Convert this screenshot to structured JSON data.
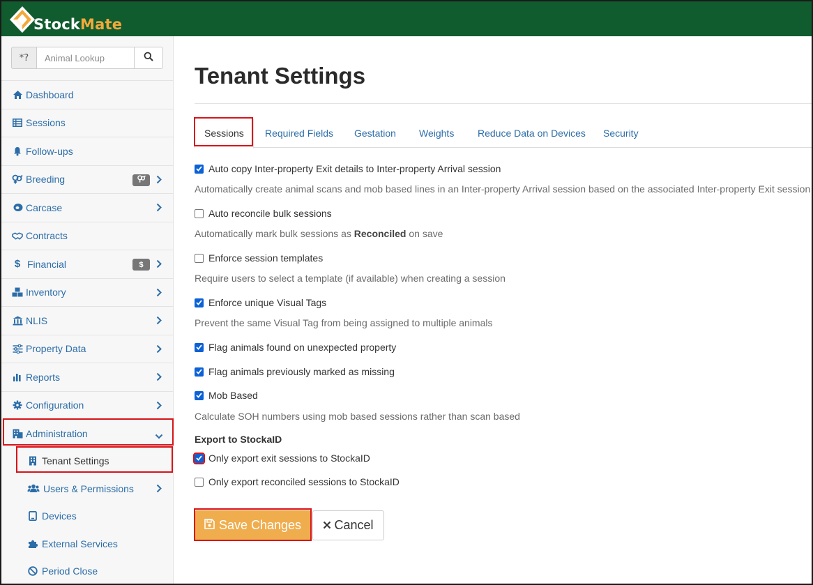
{
  "app": {
    "brand_stock": "Stock",
    "brand_mate": "Mate"
  },
  "colors": {
    "header_bg": "#105c2f",
    "brand_accent": "#f2a93b",
    "link_blue": "#2c6da8",
    "save_orange": "#f0ad4e",
    "highlight_red": "#d7141a"
  },
  "lookup": {
    "prefix": "*?",
    "placeholder": "Animal Lookup",
    "search_icon": "search-icon"
  },
  "sidebar": {
    "items": [
      {
        "label": "Dashboard",
        "icon": "home-icon"
      },
      {
        "label": "Sessions",
        "icon": "table-icon"
      },
      {
        "label": "Follow-ups",
        "icon": "bell-icon"
      },
      {
        "label": "Breeding",
        "icon": "gender-icon",
        "badge_icon": "gender-icon"
      },
      {
        "label": "Carcase",
        "icon": "steak-icon"
      },
      {
        "label": "Contracts",
        "icon": "handshake-icon"
      },
      {
        "label": "Financial",
        "icon": "dollar-icon",
        "badge": "$"
      },
      {
        "label": "Inventory",
        "icon": "boxes-icon"
      },
      {
        "label": "NLIS",
        "icon": "bank-icon"
      },
      {
        "label": "Property Data",
        "icon": "sliders-icon"
      },
      {
        "label": "Reports",
        "icon": "bar-chart-icon"
      },
      {
        "label": "Configuration",
        "icon": "gear-icon"
      },
      {
        "label": "Administration",
        "icon": "building-icon"
      }
    ],
    "sub_items": [
      {
        "label": "Tenant Settings",
        "icon": "building-icon"
      },
      {
        "label": "Users & Permissions",
        "icon": "users-icon"
      },
      {
        "label": "Devices",
        "icon": "tablet-icon"
      },
      {
        "label": "External Services",
        "icon": "puzzle-icon"
      },
      {
        "label": "Period Close",
        "icon": "ban-icon"
      }
    ]
  },
  "page": {
    "title": "Tenant Settings"
  },
  "tabs": [
    "Sessions",
    "Required Fields",
    "Gestation",
    "Weights",
    "Reduce Data on Devices",
    "Security"
  ],
  "settings": {
    "auto_copy": {
      "label": "Auto copy Inter-property Exit details to Inter-property Arrival session",
      "checked": true,
      "help": "Automatically create animal scans and mob based lines in an Inter-property Arrival session based on the associated Inter-property Exit session"
    },
    "auto_reconcile": {
      "label": "Auto reconcile bulk sessions",
      "checked": false,
      "help_prefix": "Automatically mark bulk sessions as ",
      "help_bold": "Reconciled",
      "help_suffix": " on save"
    },
    "enforce_templates": {
      "label": "Enforce session templates",
      "checked": false,
      "help": "Require users to select a template (if available) when creating a session"
    },
    "unique_tags": {
      "label": "Enforce unique Visual Tags",
      "checked": true,
      "help": "Prevent the same Visual Tag from being assigned to multiple animals"
    },
    "flag_unexpected": {
      "label": "Flag animals found on unexpected property",
      "checked": true
    },
    "flag_missing": {
      "label": "Flag animals previously marked as missing",
      "checked": true
    },
    "mob_based": {
      "label": "Mob Based",
      "checked": true,
      "help": "Calculate SOH numbers using mob based sessions rather than scan based"
    },
    "export_heading": "Export to StockaID",
    "export_exit": {
      "label": "Only export exit sessions to StockaID",
      "checked": true
    },
    "export_reconciled": {
      "label": "Only export reconciled sessions to StockaID",
      "checked": false
    }
  },
  "actions": {
    "save_label": "Save Changes",
    "cancel_label": "Cancel"
  }
}
